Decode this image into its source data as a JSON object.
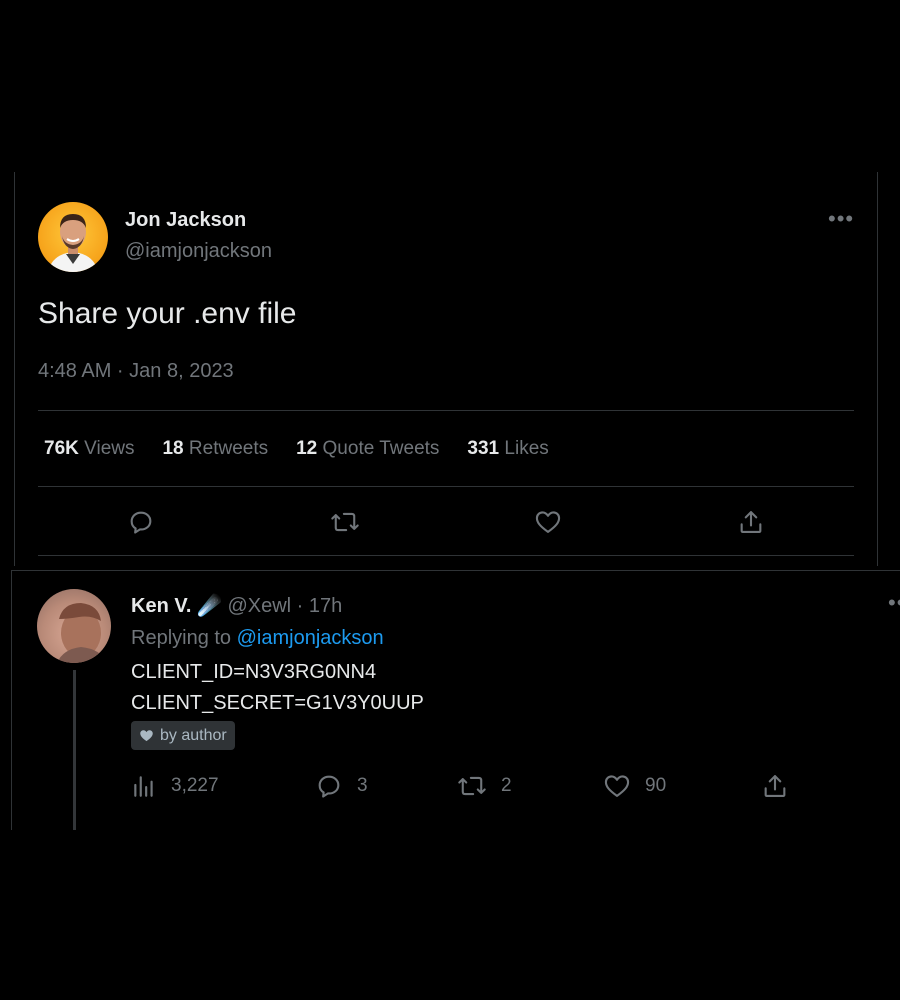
{
  "tweet": {
    "author_name": "Jon Jackson",
    "author_handle": "@iamjonjackson",
    "text": "Share your .env file",
    "timestamp": "4:48 AM · Jan 8, 2023",
    "more_icon": "more-icon",
    "stats": {
      "views_count": "76K",
      "views_label": "Views",
      "retweets_count": "18",
      "retweets_label": "Retweets",
      "quotes_count": "12",
      "quotes_label": "Quote Tweets",
      "likes_count": "331",
      "likes_label": "Likes"
    },
    "actions": [
      "reply-icon",
      "retweet-icon",
      "like-icon",
      "share-icon"
    ]
  },
  "reply": {
    "author_name": "Ken V.",
    "author_emoji": "☄️",
    "author_handle": "@Xewl",
    "separator": "·",
    "time_ago": "17h",
    "replying_prefix": "Replying to",
    "replying_handle": "@iamjonjackson",
    "lines": [
      "CLIENT_ID=N3V3RG0NN4",
      "CLIENT_SECRET=G1V3Y0UUP"
    ],
    "badge_label": "by author",
    "actions": {
      "views": "3,227",
      "replies": "3",
      "retweets": "2",
      "likes": "90"
    }
  },
  "colors": {
    "background": "#000000",
    "text": "#e7e9ea",
    "muted": "#71767b",
    "link": "#1d9bf0",
    "divider": "#2f3336"
  }
}
